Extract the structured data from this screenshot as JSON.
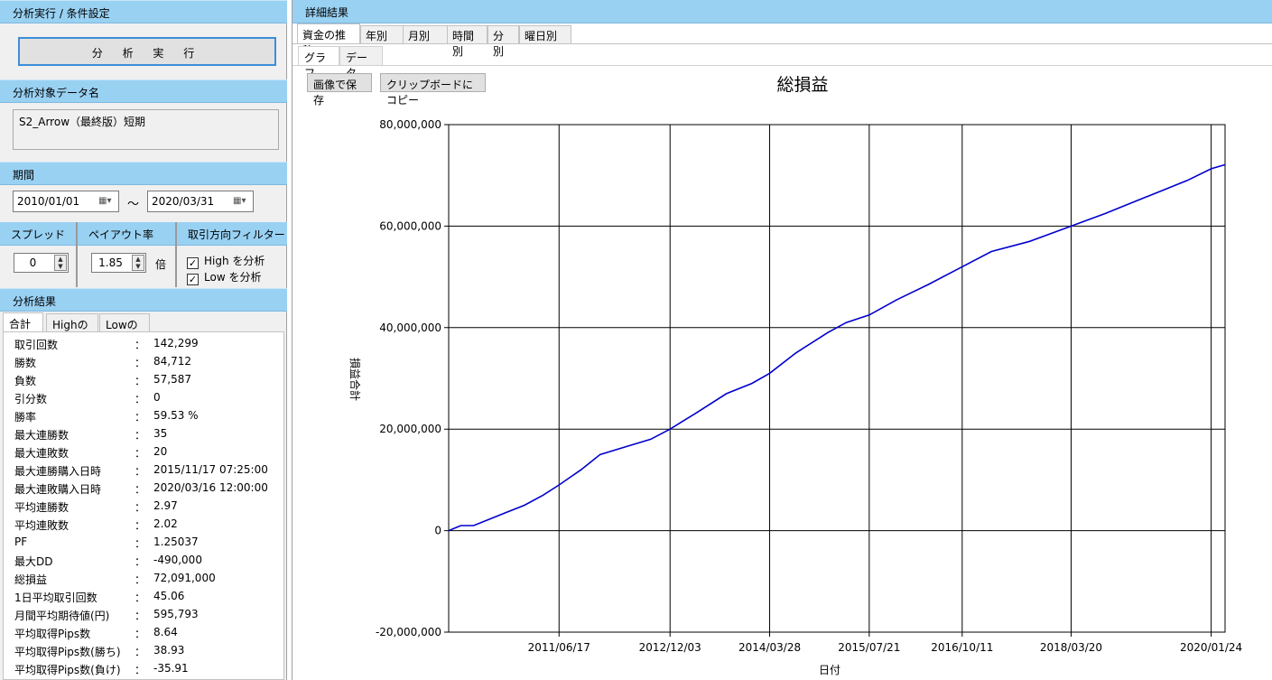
{
  "left": {
    "exec_header": "分析実行 / 条件設定",
    "run_button": "分 析 実 行",
    "target_header": "分析対象データ名",
    "target_name": "S2_Arrow（最終版）短期",
    "period_header": "期間",
    "date_from": "2010/01/01",
    "date_sep": "～",
    "date_to": "2020/03/31",
    "spread_header": "スプレッド",
    "spread_value": "0",
    "payout_header": "ペイアウト率",
    "payout_value": "1.85",
    "payout_unit": "倍",
    "filter_header": "取引方向フィルター",
    "filter_high": "High を分析",
    "filter_low": "Low を分析",
    "filter_high_checked": true,
    "filter_low_checked": true,
    "results_header": "分析結果",
    "result_tabs": [
      "合計",
      "Highのみ",
      "Lowのみ"
    ],
    "stats": [
      {
        "k": "取引回数",
        "v": "142,299"
      },
      {
        "k": "勝数",
        "v": "84,712"
      },
      {
        "k": "負数",
        "v": "57,587"
      },
      {
        "k": "引分数",
        "v": "0"
      },
      {
        "k": "勝率",
        "v": "59.53 %"
      },
      {
        "k": "最大連勝数",
        "v": "35"
      },
      {
        "k": "最大連敗数",
        "v": "20"
      },
      {
        "k": "最大連勝購入日時",
        "v": "2015/11/17 07:25:00"
      },
      {
        "k": "最大連敗購入日時",
        "v": "2020/03/16 12:00:00"
      },
      {
        "k": "平均連勝数",
        "v": "2.97"
      },
      {
        "k": "平均連敗数",
        "v": "2.02"
      },
      {
        "k": "PF",
        "v": "1.25037"
      },
      {
        "k": "最大DD",
        "v": "-490,000"
      },
      {
        "k": "総損益",
        "v": "72,091,000"
      },
      {
        "k": "1日平均取引回数",
        "v": "45.06"
      },
      {
        "k": "月間平均期待値(円)",
        "v": "595,793"
      },
      {
        "k": "平均取得Pips数",
        "v": "8.64"
      },
      {
        "k": "平均取得Pips数(勝ち)",
        "v": "38.93"
      },
      {
        "k": "平均取得Pips数(負け)",
        "v": "-35.91"
      }
    ],
    "stat_colon": "："
  },
  "right": {
    "header": "詳細結果",
    "main_tabs": [
      "資金の推移",
      "年別",
      "月別",
      "時間別",
      "分別",
      "曜日別"
    ],
    "sub_tabs": [
      "グラフ",
      "データ"
    ],
    "save_image_button": "画像で保存",
    "copy_clipboard_button": "クリップボードにコピー"
  },
  "chart_data": {
    "type": "line",
    "title": "総損益",
    "xlabel": "日付",
    "ylabel": "損益合計",
    "x_tick_labels": [
      "2011/06/17",
      "2012/12/03",
      "2014/03/28",
      "2015/07/21",
      "2016/10/11",
      "2018/03/20",
      "2020/01/24"
    ],
    "y_tick_labels": [
      "-20,000,000",
      "0",
      "20,000,000",
      "40,000,000",
      "60,000,000",
      "80,000,000"
    ],
    "ylim": [
      -20000000,
      80000000
    ],
    "xlim": [
      "2010/01/01",
      "2020/03/31"
    ],
    "grid": true,
    "line_color": "#0000cd",
    "series": [
      {
        "x": [
          "2010/01/01",
          "2010/03/01",
          "2010/05/01",
          "2010/07/01",
          "2010/10/01",
          "2011/01/01",
          "2011/04/01",
          "2011/06/17",
          "2011/10/01",
          "2012/01/01",
          "2012/05/01",
          "2012/09/01",
          "2012/12/03",
          "2013/04/01",
          "2013/09/01",
          "2014/01/01",
          "2014/03/28",
          "2014/08/01",
          "2015/01/01",
          "2015/04/01",
          "2015/07/21",
          "2015/12/01",
          "2016/05/01",
          "2016/10/11",
          "2017/03/01",
          "2017/09/01",
          "2018/03/20",
          "2018/09/01",
          "2019/04/01",
          "2019/10/01",
          "2020/01/24",
          "2020/03/31"
        ],
        "y": [
          0,
          1000000,
          1000000,
          2000000,
          3500000,
          5000000,
          7000000,
          9000000,
          12000000,
          15000000,
          16500000,
          18000000,
          20000000,
          23000000,
          27000000,
          29000000,
          31000000,
          35000000,
          39000000,
          41000000,
          42500000,
          45500000,
          48500000,
          52000000,
          55000000,
          57000000,
          60000000,
          62500000,
          66000000,
          69000000,
          71300000,
          72091000
        ]
      }
    ]
  }
}
